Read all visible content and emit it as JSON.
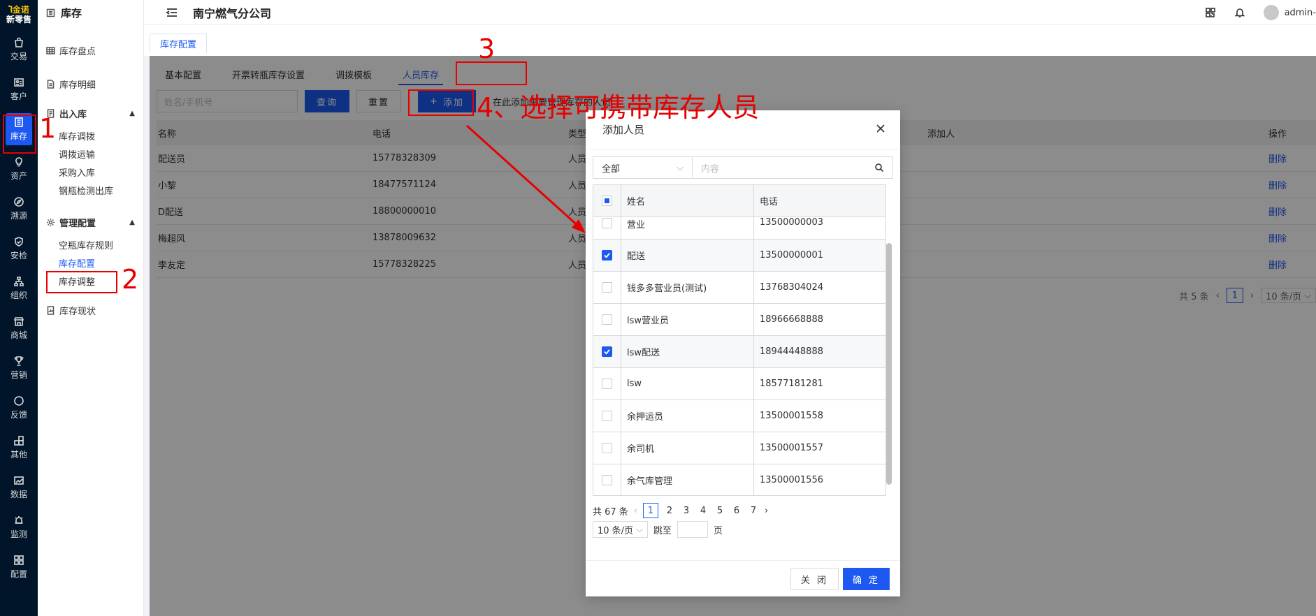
{
  "brand": {
    "line1": "金诺",
    "line2": "新零售",
    "logo_mark": "Ⴈ"
  },
  "leftnav": [
    {
      "label": "交易",
      "icon": "bag-icon"
    },
    {
      "label": "客户",
      "icon": "idcard-icon"
    },
    {
      "label": "库存",
      "icon": "list-icon"
    },
    {
      "label": "资产",
      "icon": "bulb-icon"
    },
    {
      "label": "溯源",
      "icon": "compass-icon"
    },
    {
      "label": "安检",
      "icon": "shield-icon"
    },
    {
      "label": "组织",
      "icon": "org-icon"
    },
    {
      "label": "商城",
      "icon": "shop-icon"
    },
    {
      "label": "营销",
      "icon": "trophy-icon"
    },
    {
      "label": "反馈",
      "icon": "chat-icon"
    },
    {
      "label": "其他",
      "icon": "apps-icon"
    },
    {
      "label": "数据",
      "icon": "chart-icon"
    },
    {
      "label": "监测",
      "icon": "alarm-icon"
    },
    {
      "label": "配置",
      "icon": "grid-icon"
    }
  ],
  "sidebar": {
    "title": "库存",
    "items": [
      {
        "label": "库存盘点"
      },
      {
        "label": "库存明细"
      }
    ],
    "group1": {
      "label": "出入库",
      "subs": [
        "库存调拨",
        "调拨运输",
        "采购入库",
        "钢瓶检测出库"
      ]
    },
    "group2": {
      "label": "管理配置",
      "subs": [
        "空瓶库存规则",
        "库存配置",
        "库存调整"
      ]
    },
    "last": {
      "label": "库存现状"
    }
  },
  "header": {
    "company": "南宁燃气分公司",
    "user": "admin-"
  },
  "pagetab": "库存配置",
  "subtabs": [
    "基本配置",
    "开票转瓶库存设置",
    "调拨模板",
    "人员库存"
  ],
  "filter": {
    "placeholder": "姓名/手机号",
    "query": "查询",
    "reset": "重置",
    "add": "添加",
    "hint": "在此添加需要管理库存的人员"
  },
  "table": {
    "headers": [
      "名称",
      "电话",
      "类型",
      "添加人",
      "操作"
    ],
    "rows": [
      {
        "name": "配送员",
        "phone": "15778328309",
        "type": "人员",
        "adder": "",
        "op": "删除"
      },
      {
        "name": "小黎",
        "phone": "18477571124",
        "type": "人员",
        "adder": "",
        "op": "删除"
      },
      {
        "name": "D配送",
        "phone": "18800000010",
        "type": "人员",
        "adder": "",
        "op": "删除"
      },
      {
        "name": "梅超风",
        "phone": "13878009632",
        "type": "人员",
        "adder": "",
        "op": "删除"
      },
      {
        "name": "李友定",
        "phone": "15778328225",
        "type": "人员",
        "adder": "",
        "op": "删除"
      }
    ],
    "pager": {
      "total": "共 5 条",
      "page": "1",
      "size": "10 条/页"
    }
  },
  "modal": {
    "title": "添加人员",
    "select": "全部",
    "search_placeholder": "内容",
    "headers": {
      "name": "姓名",
      "phone": "电话"
    },
    "rows": [
      {
        "name": "营业",
        "phone": "13500000003",
        "checked": false
      },
      {
        "name": "配送",
        "phone": "13500000001",
        "checked": true
      },
      {
        "name": "钱多多营业员(测试)",
        "phone": "13768304024",
        "checked": false
      },
      {
        "name": "lsw营业员",
        "phone": "18966668888",
        "checked": false
      },
      {
        "name": "lsw配送",
        "phone": "18944448888",
        "checked": true
      },
      {
        "name": "lsw",
        "phone": "18577181281",
        "checked": false
      },
      {
        "name": "余押运员",
        "phone": "13500001558",
        "checked": false
      },
      {
        "name": "余司机",
        "phone": "13500001557",
        "checked": false
      },
      {
        "name": "余气库管理",
        "phone": "13500001556",
        "checked": false
      }
    ],
    "pager": {
      "total": "共 67 条",
      "pages": [
        "1",
        "2",
        "3",
        "4",
        "5",
        "6",
        "7"
      ],
      "size": "10 条/页",
      "goto": "跳至",
      "page_unit": "页"
    },
    "cancel": "关 闭",
    "ok": "确 定"
  },
  "annotations": {
    "n1": "1",
    "n2": "2",
    "n3": "3",
    "n4": "4、选择可携带库存人员"
  },
  "colors": {
    "primary": "#1d59f0",
    "nav_bg": "#001529",
    "annotation": "#e60000"
  }
}
